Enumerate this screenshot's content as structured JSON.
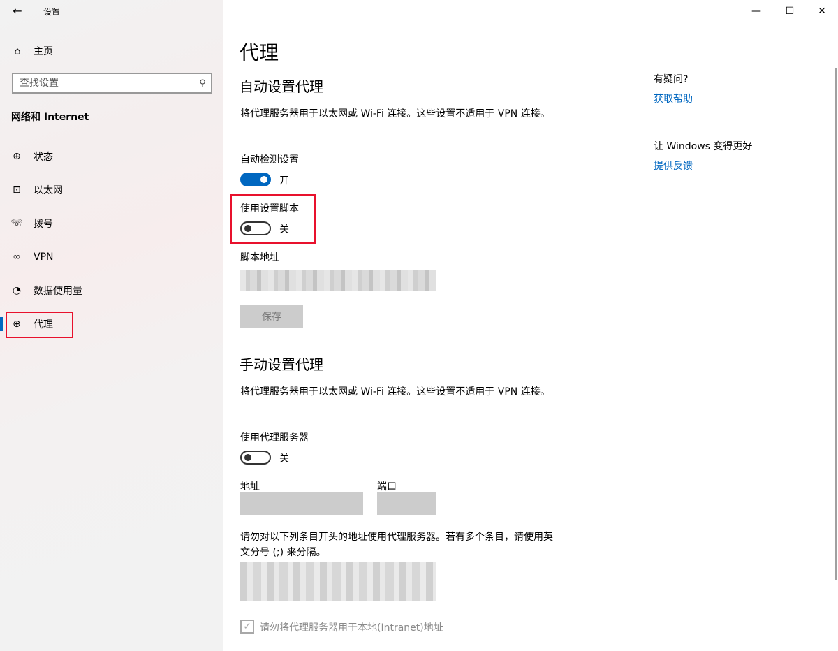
{
  "window": {
    "title": "设置",
    "back_icon": "←",
    "minimize": "—",
    "maximize": "☐",
    "close": "✕"
  },
  "sidebar": {
    "home_label": "主页",
    "search_placeholder": "查找设置",
    "section_title": "网络和 Internet",
    "items": [
      {
        "label": "状态",
        "icon": "globe-status-icon",
        "glyph": "⊕"
      },
      {
        "label": "以太网",
        "icon": "ethernet-icon",
        "glyph": "⊡"
      },
      {
        "label": "拨号",
        "icon": "dialup-icon",
        "glyph": "☏"
      },
      {
        "label": "VPN",
        "icon": "vpn-icon",
        "glyph": "∞"
      },
      {
        "label": "数据使用量",
        "icon": "data-usage-icon",
        "glyph": "◔"
      },
      {
        "label": "代理",
        "icon": "globe-icon",
        "glyph": "⊕",
        "active": true
      }
    ]
  },
  "main": {
    "page_title": "代理",
    "auto": {
      "heading": "自动设置代理",
      "description": "将代理服务器用于以太网或 Wi-Fi 连接。这些设置不适用于 VPN 连接。",
      "detect_label": "自动检测设置",
      "detect_state": "开",
      "script_label": "使用设置脚本",
      "script_state": "关",
      "script_address_label": "脚本地址",
      "save_label": "保存"
    },
    "manual": {
      "heading": "手动设置代理",
      "description": "将代理服务器用于以太网或 Wi-Fi 连接。这些设置不适用于 VPN 连接。",
      "use_proxy_label": "使用代理服务器",
      "use_proxy_state": "关",
      "address_label": "地址",
      "port_label": "端口",
      "exceptions_description": "请勿对以下列条目开头的地址使用代理服务器。若有多个条目，请使用英文分号 (;) 来分隔。",
      "local_checkbox_label": "请勿将代理服务器用于本地(Intranet)地址"
    }
  },
  "help": {
    "title": "有疑问?",
    "get_help": "获取帮助",
    "improve_title": "让 Windows 变得更好",
    "feedback": "提供反馈"
  },
  "colors": {
    "accent": "#0067c0",
    "highlight_box": "#e8112d"
  }
}
